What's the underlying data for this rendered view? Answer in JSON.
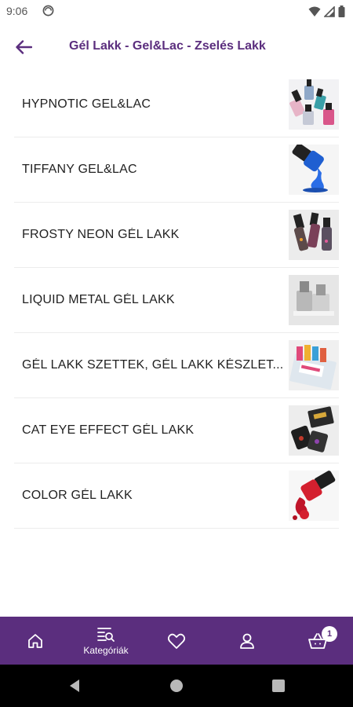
{
  "status": {
    "time": "9:06"
  },
  "app_bar": {
    "title": "Gél Lakk - Gel&Lac - Zselés Lakk",
    "back_icon": "arrow-left-icon"
  },
  "categories": [
    {
      "label": "HYPNOTIC GEL&LAC",
      "thumb": "nail-polish-bottles"
    },
    {
      "label": "TIFFANY GEL&LAC",
      "thumb": "blue-polish-splash"
    },
    {
      "label": "FROSTY NEON GÉL LAKK",
      "thumb": "neon-polish-bottles"
    },
    {
      "label": "LIQUID METAL GÉL LAKK",
      "thumb": "metal-polish-bottles"
    },
    {
      "label": "GÉL LAKK SZETTEK, GÉL LAKK KÉSZLET...",
      "thumb": "gel-polish-set"
    },
    {
      "label": "CAT EYE EFFECT GÉL LAKK",
      "thumb": "cat-eye-polish"
    },
    {
      "label": "COLOR GÉL LAKK",
      "thumb": "red-polish-splash"
    }
  ],
  "bottom_nav": {
    "items": [
      {
        "icon": "home-icon",
        "label": ""
      },
      {
        "icon": "categories-icon",
        "label": "Kategóriák"
      },
      {
        "icon": "heart-icon",
        "label": ""
      },
      {
        "icon": "user-icon",
        "label": ""
      },
      {
        "icon": "cart-icon",
        "label": ""
      }
    ],
    "cart_count": "1"
  },
  "colors": {
    "brand": "#5b2e7e",
    "text": "#222222",
    "divider": "#ececec"
  }
}
